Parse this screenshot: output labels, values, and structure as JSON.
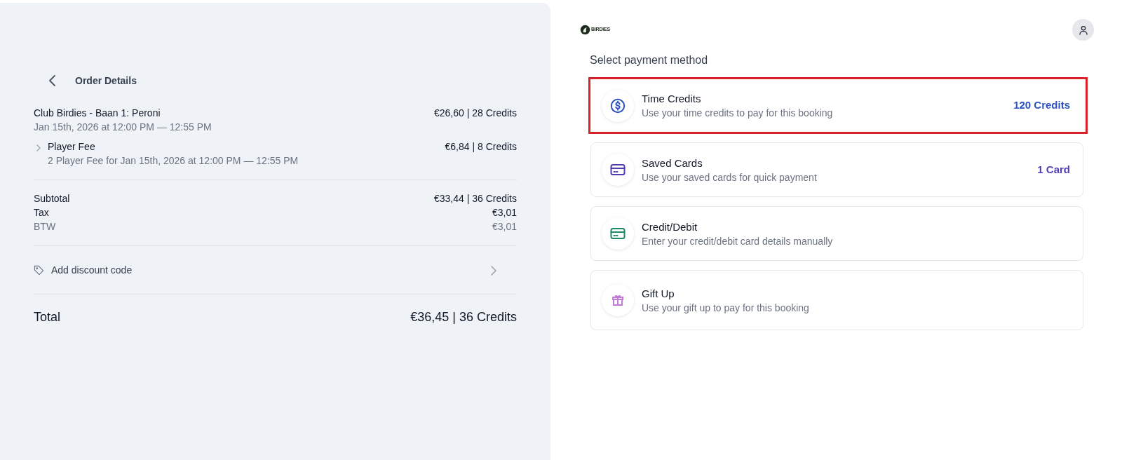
{
  "order": {
    "title": "Order Details",
    "items": [
      {
        "name": "Club Birdies - Baan 1: Peroni",
        "detail": "Jan 15th, 2026 at 12:00 PM — 12:55 PM",
        "amount": "€26,60 | 28 Credits",
        "children": [
          {
            "name": "Player Fee",
            "detail": "2 Player Fee for Jan 15th, 2026 at 12:00 PM — 12:55 PM",
            "amount": "€6,84 | 8 Credits",
            "expanded": false
          }
        ]
      }
    ],
    "summary": [
      {
        "kind": "main",
        "label": "Subtotal",
        "amount": "€33,44 | 36 Credits"
      },
      {
        "kind": "main",
        "label": "Tax",
        "amount": "€3,01"
      },
      {
        "kind": "sub",
        "label": "BTW",
        "amount": "€3,01"
      }
    ],
    "discount": {
      "label": "Add discount code"
    },
    "total": {
      "label": "Total",
      "amount": "€36,45 | 36 Credits"
    }
  },
  "header": {
    "logo": "BIRDIES"
  },
  "payment": {
    "title": "Select payment method",
    "methods": [
      {
        "kind": "coin",
        "title": "Time Credits",
        "description": "Use your time credits to pay for this booking",
        "balance": "120 Credits",
        "color": "#2c52c0",
        "highlighted": true
      },
      {
        "kind": "card",
        "title": "Saved Cards",
        "description": "Use your saved cards for quick payment",
        "balance": "1 Card",
        "color": "#4f3db6",
        "highlighted": false
      },
      {
        "kind": "card",
        "title": "Credit/Debit",
        "description": "Enter your credit/debit card details manually",
        "color": "#1f8a66",
        "highlighted": false
      },
      {
        "kind": "gift",
        "title": "Gift Up",
        "description": "Use your gift up to pay for this booking",
        "color": "#c27ad8",
        "highlighted": false
      }
    ]
  }
}
